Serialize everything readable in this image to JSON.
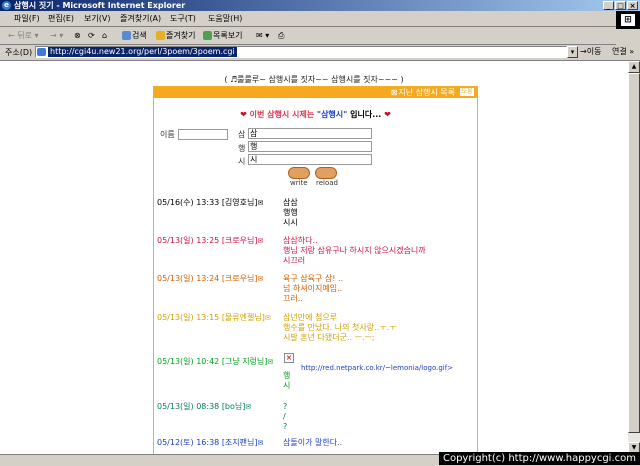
{
  "window": {
    "title": "삼행시 짓기 - Microsoft Internet Explorer",
    "btn_min": "_",
    "btn_max": "□",
    "btn_close": "×"
  },
  "menu": [
    "파일(F)",
    "편집(E)",
    "보기(V)",
    "즐겨찾기(A)",
    "도구(T)",
    "도움말(H)"
  ],
  "toolbar": {
    "back": "← 뒤로",
    "forward": "→",
    "stop": "⊗",
    "refresh": "⟳",
    "home": "⌂",
    "search": "검색",
    "favorites": "즐겨찾기",
    "history": "목록보기",
    "mail": "✉",
    "print": "⎙"
  },
  "address": {
    "label": "주소(D)",
    "url": "http://cgi4u.new21.org/perl/3poem/3poem.cgi",
    "dropdown": "▾",
    "go": "→이동",
    "links": "연결 »"
  },
  "page": {
    "heading": "( ♬룰룰루~ 삼행시를 짓자~~ 삼행시를 짓자~~~ )",
    "prev_link": "지난 삼행시 목록",
    "help_icon": "도움",
    "intro_prefix": "이번 삼행시 시제는",
    "intro_keyword": "\"삼행시\"",
    "intro_suffix": "입니다...",
    "heart": "❤",
    "form": {
      "name_label": "이름",
      "name_value": "",
      "rows": [
        {
          "label": "삼",
          "value": "삼"
        },
        {
          "label": "행",
          "value": "행"
        },
        {
          "label": "시",
          "value": "시"
        }
      ],
      "write_label": "write",
      "reload_label": "reload"
    },
    "entries": [
      {
        "date": "05/16(수) 13:33",
        "author": "[김영호님]",
        "mail": "✉",
        "color": "#000000",
        "lines": [
          "삼삼",
          "행행",
          "시시"
        ]
      },
      {
        "date": "05/13(일) 13:25",
        "author": "[크로우님]",
        "mail": "✉",
        "color": "#d01040",
        "lines": [
          "삼삼하다..",
          "행님 저랑 삼유구나 하시지 않으시겠습니까",
          "시끄러"
        ]
      },
      {
        "date": "05/13(일) 13:24",
        "author": "[크로우님]",
        "mail": "✉",
        "color": "#d06000",
        "lines": [
          "육구 삼육구 삼! ..",
          "넘 하셔이지예임..",
          "끄러.."
        ]
      },
      {
        "date": "05/13(일) 13:15",
        "author": "[물류엔젤님]",
        "mail": "✉",
        "color": "#d0a000",
        "lines": [
          "삼년만에 첨으루",
          "행수를 만났다. 나의 첫사랑..ㅜ.ㅜ",
          "시발 혼년 다됐더군.. ㅡ.ㅡ;"
        ]
      },
      {
        "date": "05/13(일) 10:42",
        "author": "[그냥 지렁님]",
        "mail": "✉",
        "color": "#00a020",
        "image_url": "http://red.netpark.co.kr/~lemonia/logo.gif>",
        "lines": [
          "행",
          "시"
        ]
      },
      {
        "date": "05/13(일) 08:38",
        "author": "[bo님]",
        "mail": "✉",
        "color": "#008050",
        "lines": [
          "?",
          "/",
          "?"
        ]
      },
      {
        "date": "05/12(토) 16:38",
        "author": "[조지팬님]",
        "mail": "✉",
        "color": "#2040c0",
        "lines": [
          "삼돌이가 말한다.."
        ]
      }
    ]
  },
  "watermark": "Copyright(c) http://www.happycgi.com",
  "scroll": {
    "up": "▲",
    "down": "▼"
  },
  "colors": {
    "accent": "#f6a81e",
    "title_bar": "#0a246a",
    "address_highlight": "#0a246a"
  }
}
